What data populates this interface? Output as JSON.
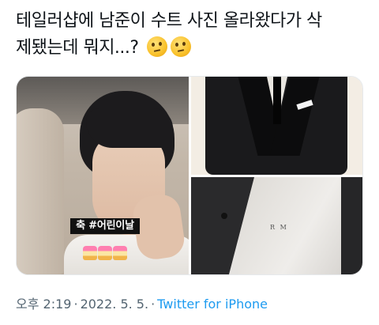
{
  "tweet": {
    "line1": "테일러샵에 남준이 수트 사진 올라왔다가 삭",
    "line2": "제됐는데 뭐지...? ",
    "emoji_1": "thinking-face-emoji",
    "emoji_2": "thinking-face-emoji"
  },
  "media": {
    "photo_1": {
      "sticker_text": "축 #어린이날",
      "sticker_icon": "birthday-cake-sticker"
    },
    "photo_2": {
      "subject": "suit-jacket"
    },
    "photo_3": {
      "monogram_text": "R M"
    }
  },
  "meta": {
    "time": "오후 2:19",
    "separator": "·",
    "date": "2022. 5. 5.",
    "source": "Twitter for iPhone"
  },
  "colors": {
    "text": "#0f1419",
    "secondary": "#536471",
    "link": "#1d9bf0"
  }
}
